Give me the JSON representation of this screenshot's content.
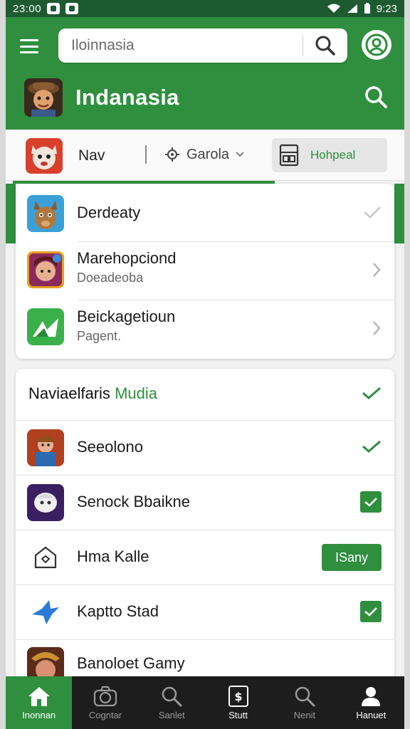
{
  "status_bar": {
    "time_left": "23:00",
    "time_right": "9:23"
  },
  "header": {
    "search": {
      "value": "Iloinnasia",
      "placeholder": "Iloinnasia"
    },
    "title": "Indanasia"
  },
  "tabs": {
    "nav_label": "Nav",
    "filter_label": "Garola",
    "active_label": "Hohpeal"
  },
  "list1": [
    {
      "title": "Derdeaty",
      "subtitle": "",
      "trail": "check"
    },
    {
      "title": "Marehopciond",
      "subtitle": "Doeadeoba",
      "trail": "chevron"
    },
    {
      "title": "Beickagetioun",
      "subtitle": "Pagent.",
      "trail": "chevron"
    }
  ],
  "section2": {
    "title_main": "Naviaelfaris",
    "title_accent": "Mudia"
  },
  "list2": [
    {
      "title": "Seeolono",
      "trail": "check"
    },
    {
      "title": "Senock Bbaikne",
      "trail": "checkbox"
    },
    {
      "title": "Hma Kalle",
      "trail": "button",
      "button_label": "ISany"
    },
    {
      "title": "Kaptto Stad",
      "trail": "checkbox"
    },
    {
      "title": "Banoloet Gamy",
      "trail": "none"
    }
  ],
  "bottom_nav": [
    {
      "label": "Inonnan",
      "icon": "home-icon"
    },
    {
      "label": "Cogntar",
      "icon": "camera-icon"
    },
    {
      "label": "Sanlet",
      "icon": "search-icon"
    },
    {
      "label": "Stutt",
      "icon": "dollar-icon"
    },
    {
      "label": "Nenit",
      "icon": "search-icon"
    },
    {
      "label": "Hanuet",
      "icon": "person-icon"
    }
  ],
  "colors": {
    "primary": "#2f8f3e",
    "status_bar": "#1d5a2f",
    "bottom_nav_bg": "#1d1d1d"
  }
}
